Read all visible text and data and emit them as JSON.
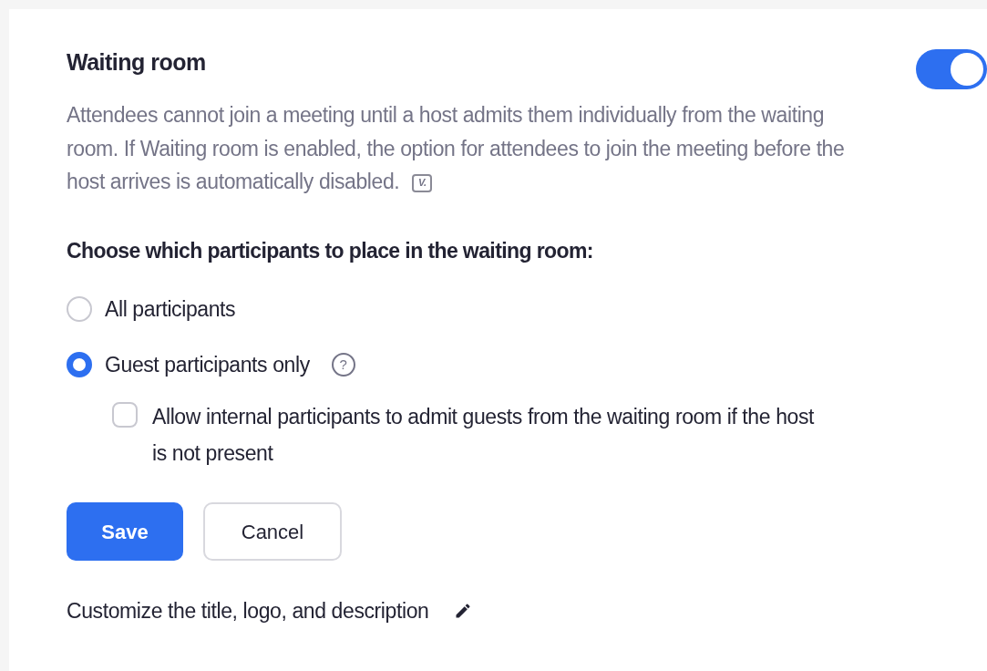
{
  "setting": {
    "title": "Waiting room",
    "on": true,
    "description": "Attendees cannot join a meeting until a host admits them individually from the waiting room. If Waiting room is enabled, the option for attendees to join the meeting before the host arrives is automatically disabled.",
    "badge": "V."
  },
  "question": "Choose which participants to place in the waiting room:",
  "options": [
    {
      "label": "All participants",
      "selected": false
    },
    {
      "label": "Guest participants only",
      "selected": true,
      "help": "?"
    }
  ],
  "sub_option": {
    "label": "Allow internal participants to admit guests from the waiting room if the host is not present",
    "checked": false
  },
  "buttons": [
    {
      "label": "Save",
      "kind": "primary"
    },
    {
      "label": "Cancel",
      "kind": "secondary"
    }
  ],
  "customize": {
    "label": "Customize the title, logo, and description"
  }
}
